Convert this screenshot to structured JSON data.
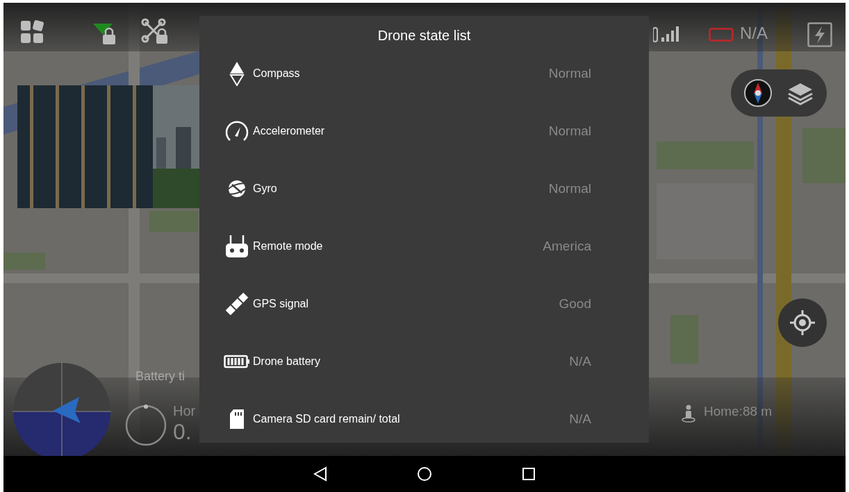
{
  "status_bar": {
    "battery_reading": "N/A"
  },
  "dialog": {
    "title": "Drone state list",
    "items": [
      {
        "kind": "compass",
        "label": "Compass",
        "value": "Normal"
      },
      {
        "kind": "accelerometer",
        "label": "Accelerometer",
        "value": "Normal"
      },
      {
        "kind": "gyro",
        "label": "Gyro",
        "value": "Normal"
      },
      {
        "kind": "remote",
        "label": "Remote mode",
        "value": "America"
      },
      {
        "kind": "gps",
        "label": "GPS signal",
        "value": "Good"
      },
      {
        "kind": "battery",
        "label": "Drone battery",
        "value": "N/A"
      },
      {
        "kind": "sdcard",
        "label": "Camera SD card remain/ total",
        "value": "N/A"
      }
    ]
  },
  "hud": {
    "battery_time_label": "Battery ti",
    "horizontal_label": "Hor",
    "horizontal_value": "0.",
    "home_distance": "Home:88 m"
  }
}
